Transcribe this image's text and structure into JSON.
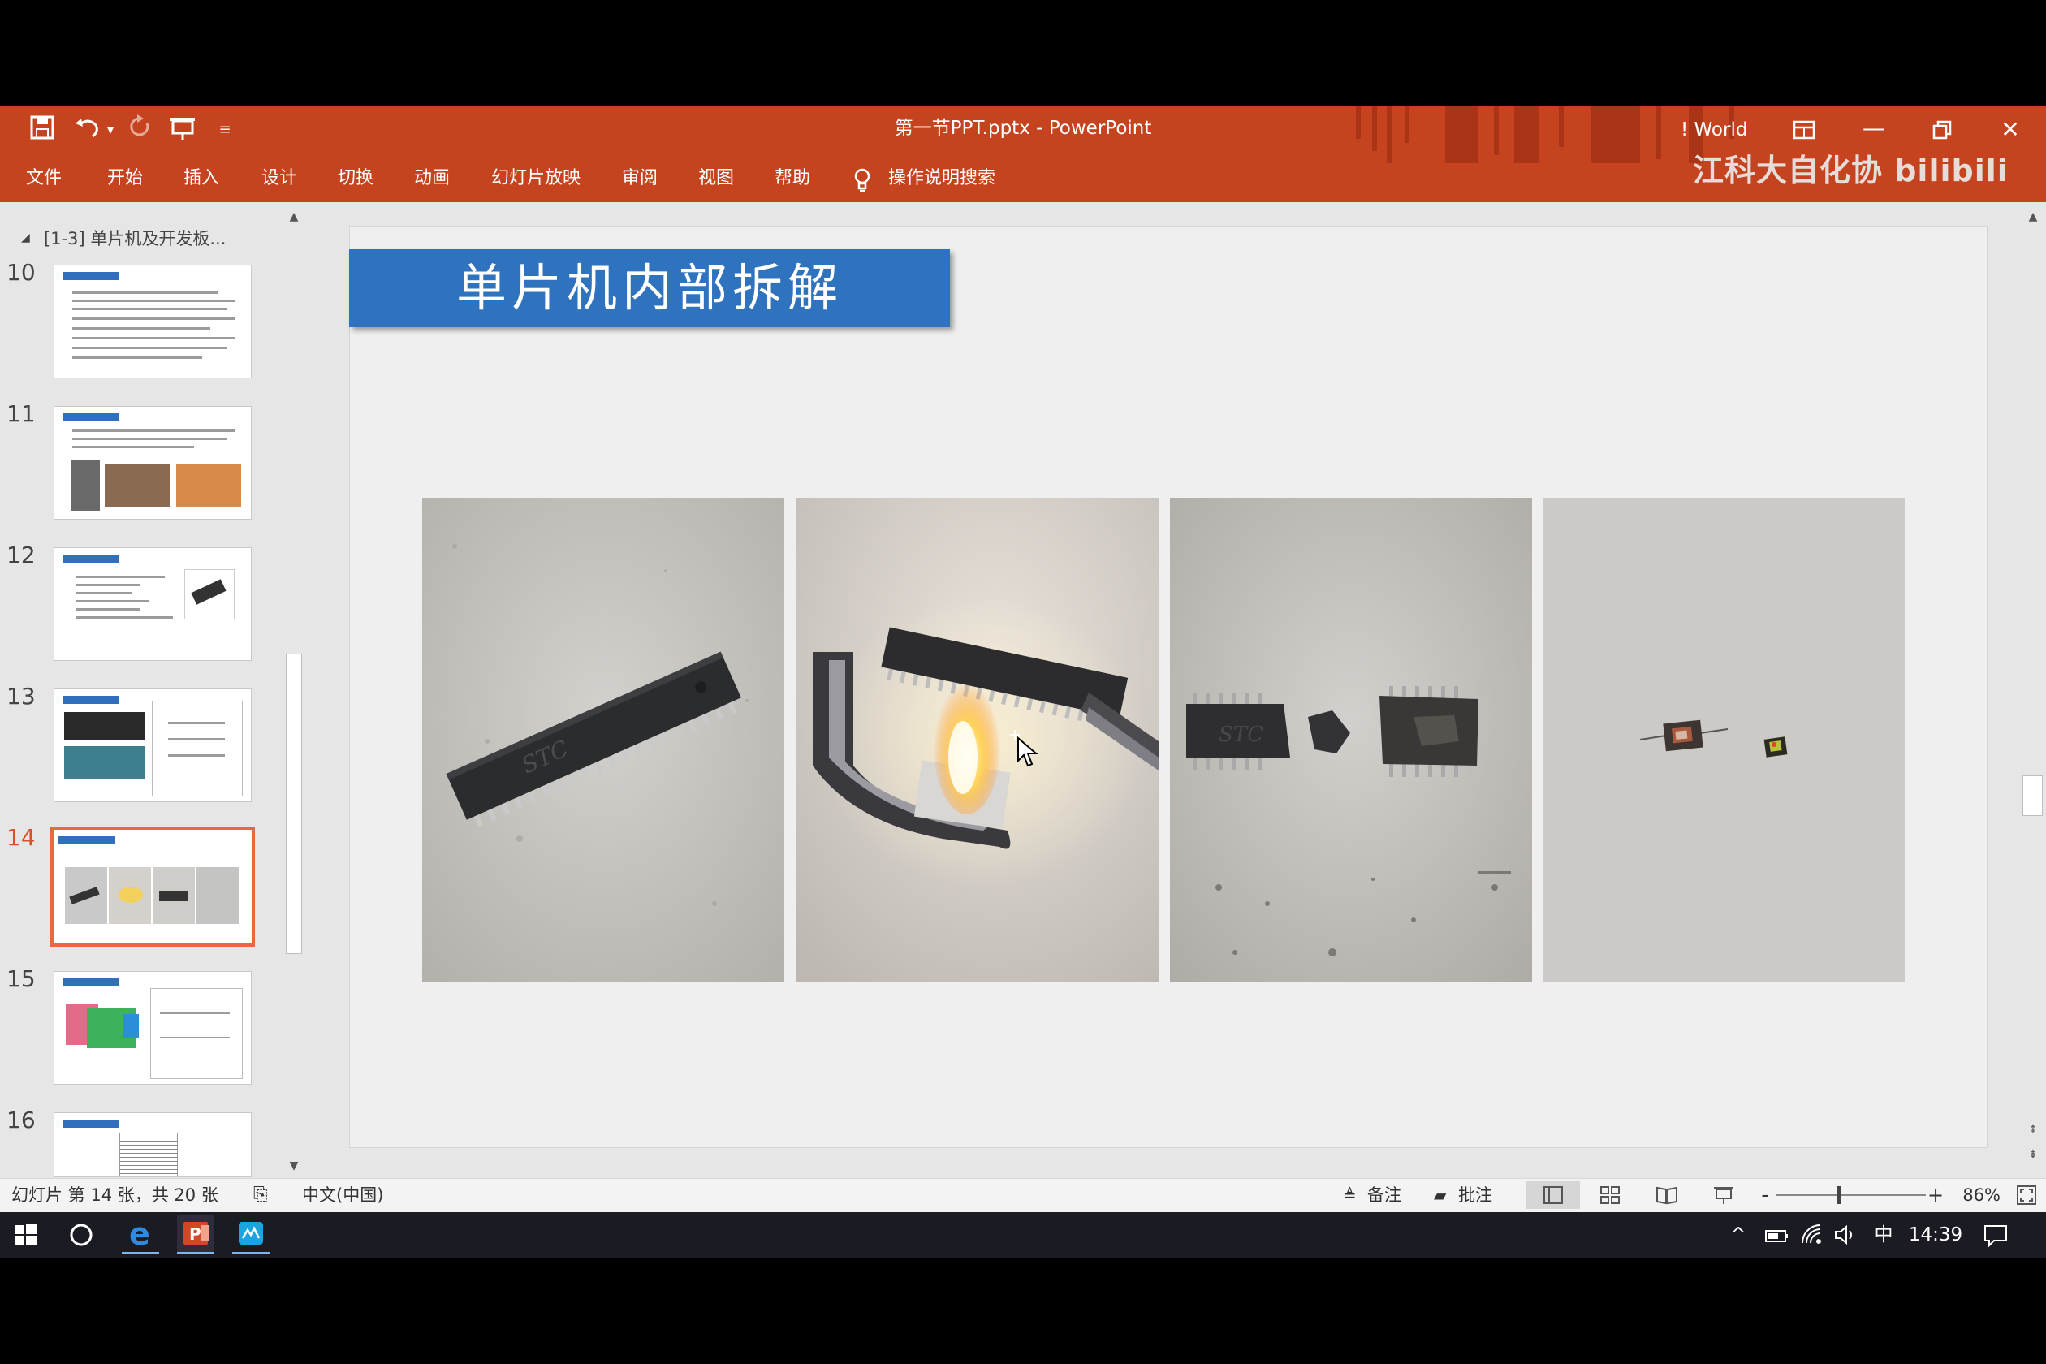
{
  "window": {
    "title": "第一节PPT.pptx  -  PowerPoint",
    "user": "! World",
    "watermark": "江科大自化协 bilibili"
  },
  "quick_access": {
    "save_icon": "save-icon",
    "undo_icon": "undo-icon",
    "redo_icon": "redo-icon",
    "present_icon": "present-from-start-icon",
    "customize_icon": "chevron-down-icon"
  },
  "ribbon": {
    "tabs": [
      "文件",
      "开始",
      "插入",
      "设计",
      "切换",
      "动画",
      "幻灯片放映",
      "审阅",
      "视图",
      "帮助"
    ],
    "search_label": "操作说明搜索"
  },
  "thumbnail_pane": {
    "section": "[1-3] 单片机及开发板...",
    "slides": [
      {
        "number": "10",
        "selected": false
      },
      {
        "number": "11",
        "selected": false
      },
      {
        "number": "12",
        "selected": false
      },
      {
        "number": "13",
        "selected": false
      },
      {
        "number": "14",
        "selected": true
      },
      {
        "number": "15",
        "selected": false
      },
      {
        "number": "16",
        "selected": false
      }
    ]
  },
  "slide": {
    "title": "单片机内部拆解",
    "images": [
      "intact-chip-photo",
      "burning-chip-photo",
      "broken-chip-photo",
      "die-photo"
    ]
  },
  "statusbar": {
    "slide_info": "幻灯片 第 14 张，共 20 张",
    "language": "中文(中国)",
    "notes_label": "备注",
    "comments_label": "批注",
    "zoom": "86%",
    "zoom_minus": "-",
    "zoom_plus": "+"
  },
  "taskbar": {
    "ime": "中",
    "time": "14:39"
  },
  "colors": {
    "ribbon": "#c5431f",
    "slide_title_bg": "#2f72be",
    "selected_thumb": "#e8693d"
  }
}
